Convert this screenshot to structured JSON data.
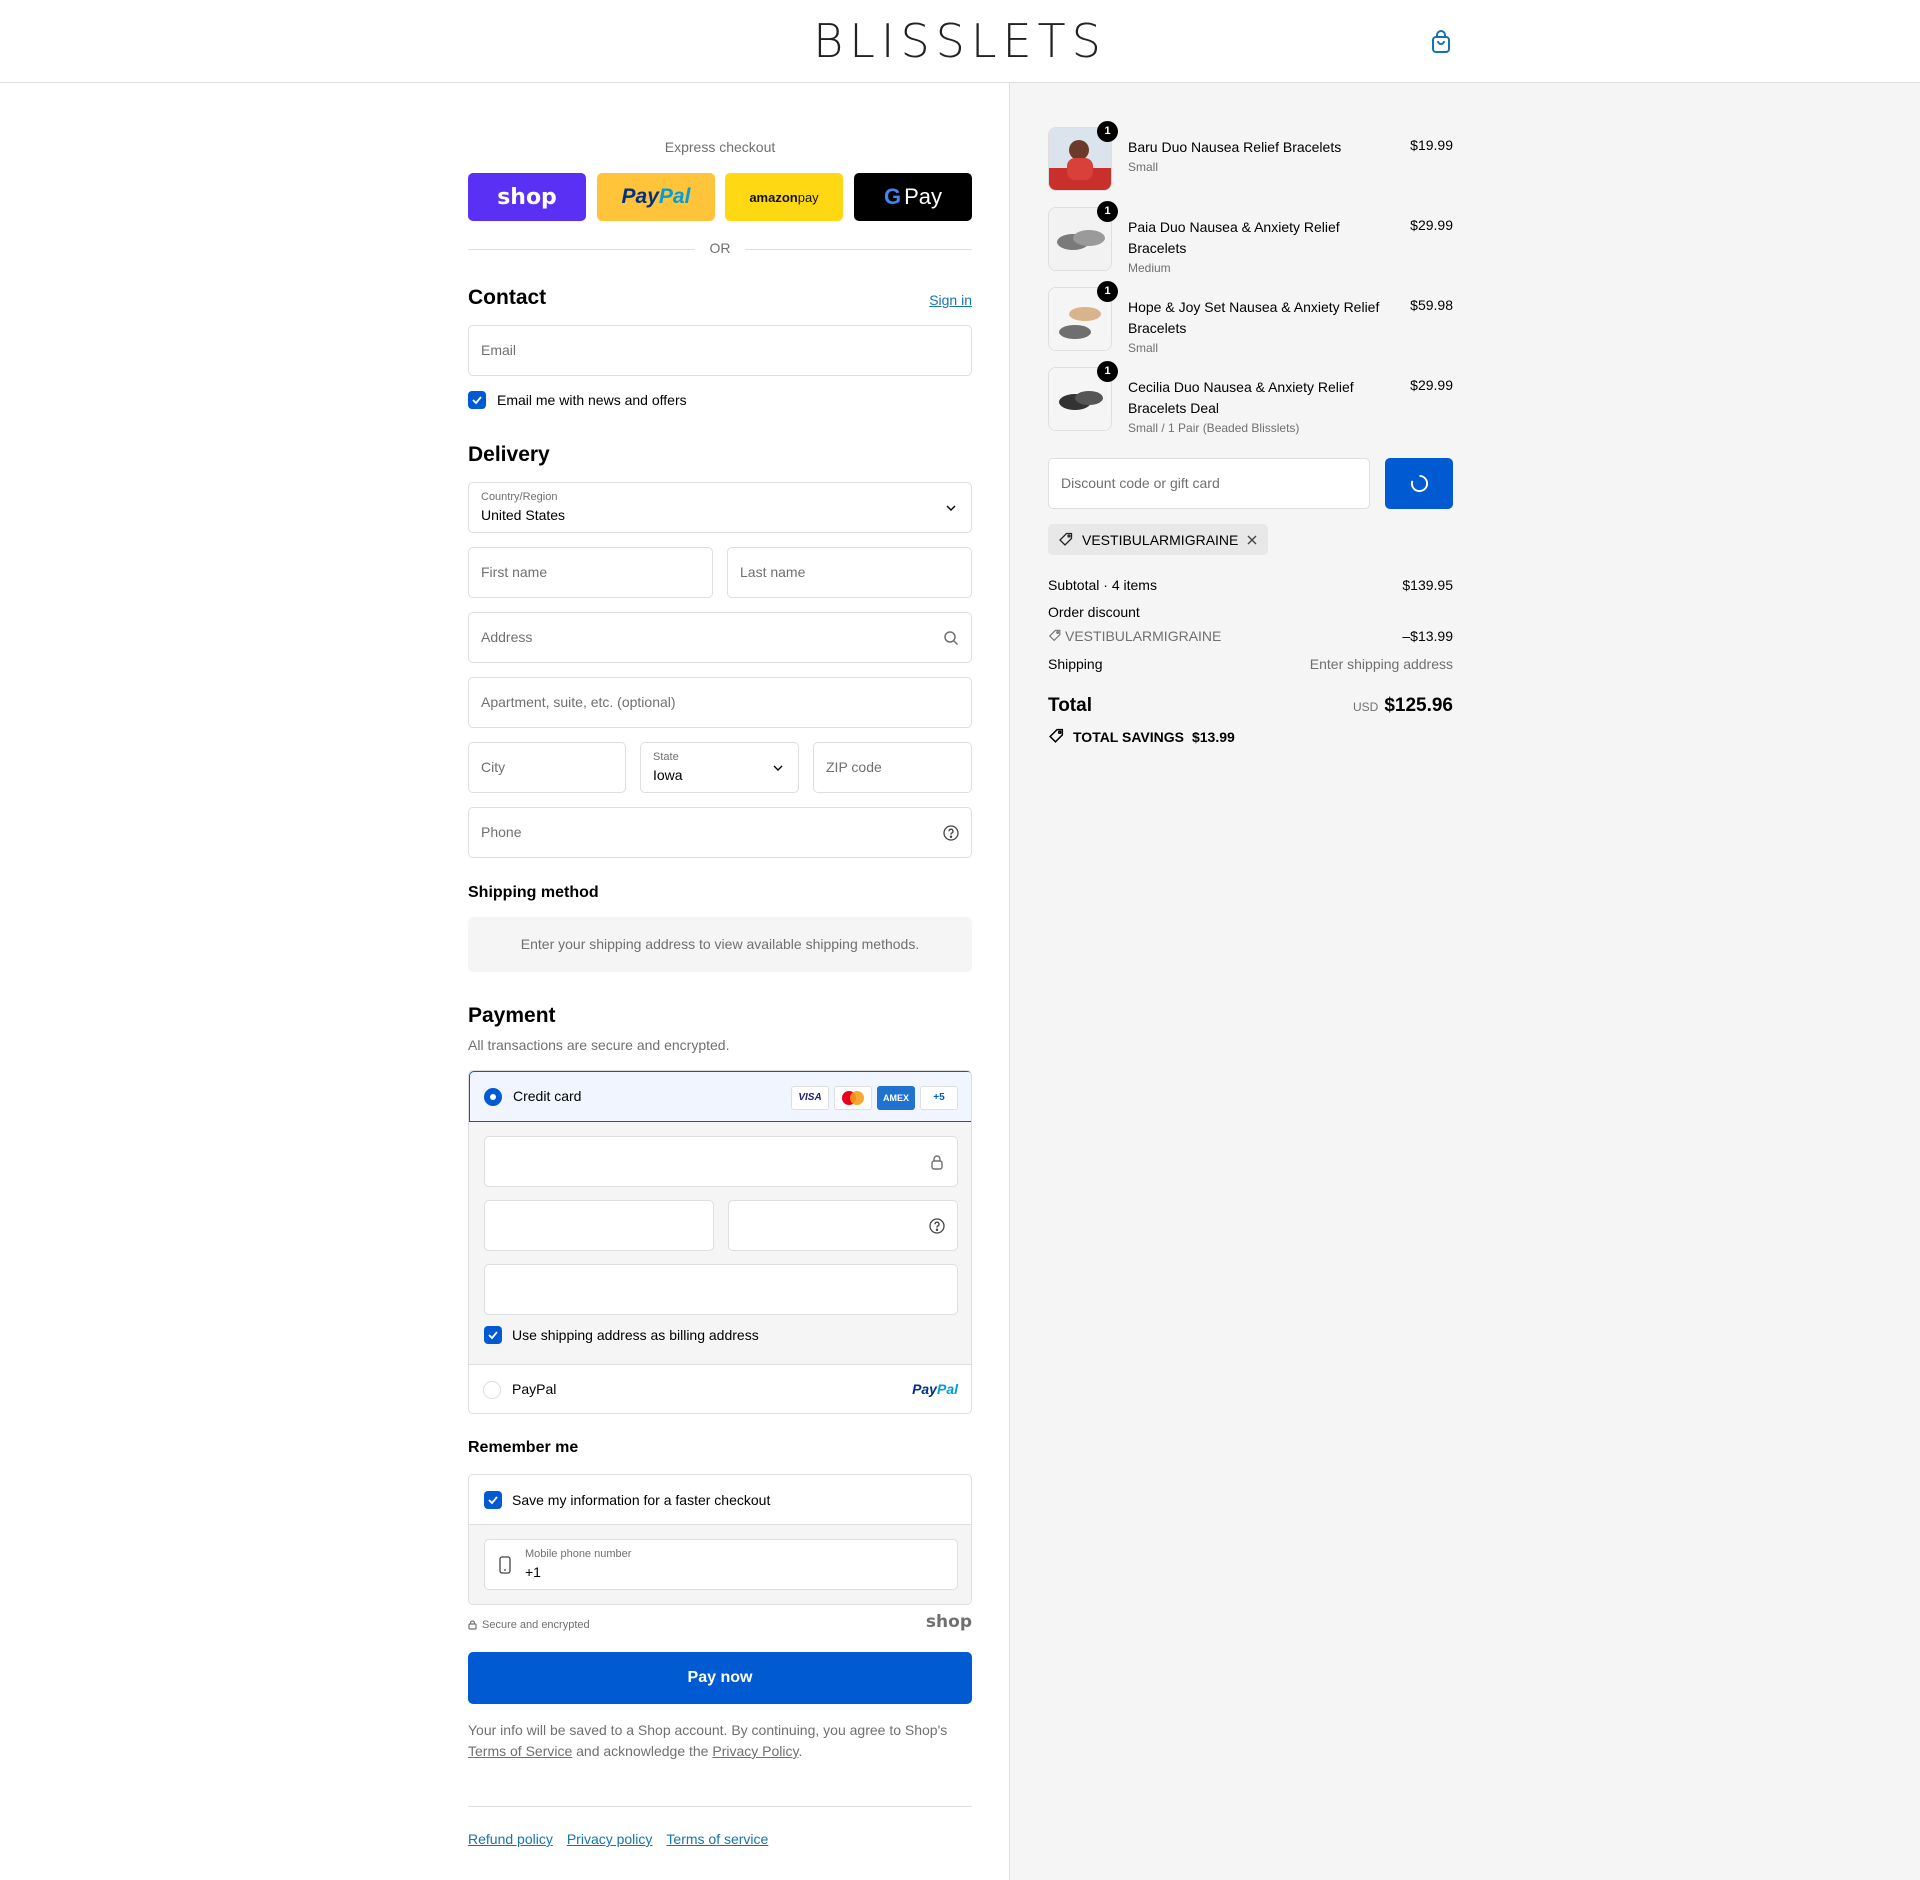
{
  "header": {
    "brand": "BLISSLETS",
    "cart_icon": "shopping-bag-icon"
  },
  "express": {
    "label": "Express checkout",
    "shop": "shop",
    "paypal_a": "Pay",
    "paypal_b": "Pal",
    "amazon_a": "amazon",
    "amazon_b": " pay",
    "gpay_g": "G",
    "gpay_text": "Pay",
    "or": "OR"
  },
  "contact": {
    "title": "Contact",
    "sign_in": "Sign in",
    "email_placeholder": "Email",
    "news_label": "Email me with news and offers"
  },
  "delivery": {
    "title": "Delivery",
    "country_label": "Country/Region",
    "country_value": "United States",
    "first_name": "First name",
    "last_name": "Last name",
    "address": "Address",
    "apartment": "Apartment, suite, etc. (optional)",
    "city": "City",
    "state_label": "State",
    "state_value": "Iowa",
    "zip": "ZIP code",
    "phone": "Phone"
  },
  "shipping_method": {
    "title": "Shipping method",
    "message": "Enter your shipping address to view available shipping methods."
  },
  "payment": {
    "title": "Payment",
    "subtitle": "All transactions are secure and encrypted.",
    "credit_card": "Credit card",
    "cards": [
      "VISA",
      "MC",
      "AMEX",
      "+5"
    ],
    "billing_label": "Use shipping address as billing address",
    "paypal": "PayPal",
    "paypal_logo_a": "Pay",
    "paypal_logo_b": "Pal"
  },
  "remember": {
    "title": "Remember me",
    "save_label": "Save my information for a faster checkout",
    "mobile_label": "Mobile phone number",
    "mobile_value": "+1",
    "secure": "Secure and encrypted",
    "shop_logo": "shop"
  },
  "pay_now": "Pay now",
  "legal": {
    "part1": "Your info will be saved to a Shop account. By continuing, you agree to Shop's ",
    "terms": "Terms of Service",
    "part2": " and acknowledge the ",
    "privacy": "Privacy Policy",
    "part3": "."
  },
  "footer": {
    "refund": "Refund policy",
    "privacy": "Privacy policy",
    "terms": "Terms of service"
  },
  "summary": {
    "items": [
      {
        "qty": "1",
        "name": "Baru Duo Nausea Relief Bracelets",
        "variant": "Small",
        "price": "$19.99"
      },
      {
        "qty": "1",
        "name": "Paia Duo Nausea & Anxiety Relief Bracelets",
        "variant": "Medium",
        "price": "$29.99"
      },
      {
        "qty": "1",
        "name": "Hope & Joy Set Nausea & Anxiety Relief Bracelets",
        "variant": "Small",
        "price": "$59.98"
      },
      {
        "qty": "1",
        "name": "Cecilia Duo Nausea & Anxiety Relief Bracelets Deal",
        "variant": "Small / 1 Pair (Beaded Blisslets)",
        "price": "$29.99"
      }
    ],
    "discount_placeholder": "Discount code or gift card",
    "applied_code": "VESTIBULARMIGRAINE",
    "subtotal_label": "Subtotal · 4 items",
    "subtotal_value": "$139.95",
    "order_discount_label": "Order discount",
    "discount_code": "VESTIBULARMIGRAINE",
    "discount_value": "–$13.99",
    "shipping_label": "Shipping",
    "shipping_value": "Enter shipping address",
    "total_label": "Total",
    "currency": "USD",
    "total_value": "$125.96",
    "savings_label": "TOTAL SAVINGS",
    "savings_value": "$13.99"
  },
  "colors": {
    "accent": "#005bd3",
    "link": "#1773b0",
    "shop_purple": "#5a31f4"
  }
}
